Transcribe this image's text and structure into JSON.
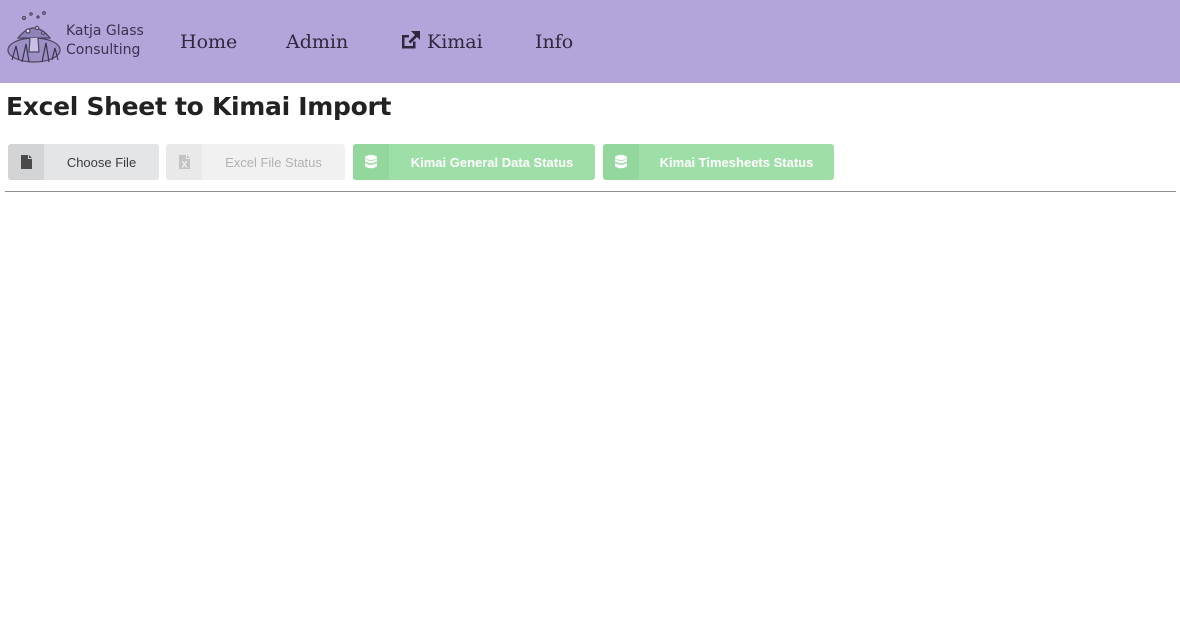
{
  "brand": {
    "line1": "Katja Glass",
    "line2": "Consulting",
    "logo_icon": "mushroom-logo"
  },
  "nav": {
    "home": "Home",
    "admin": "Admin",
    "kimai": "Kimai",
    "kimai_icon": "external-link-icon",
    "info": "Info"
  },
  "page": {
    "title": "Excel Sheet to Kimai Import"
  },
  "actions": {
    "choose_file": {
      "label": "Choose File",
      "icon": "file-icon"
    },
    "excel_status": {
      "label": "Excel File Status",
      "icon": "file-excel-icon"
    },
    "general_status": {
      "label": "Kimai General Data Status",
      "icon": "database-icon"
    },
    "timesheets_status": {
      "label": "Kimai Timesheets Status",
      "icon": "database-icon"
    }
  },
  "colors": {
    "navbar": "#b3a4da",
    "success": "#9edfa8",
    "neutral": "#e4e5e7",
    "disabled_text": "#b3b3b3"
  }
}
